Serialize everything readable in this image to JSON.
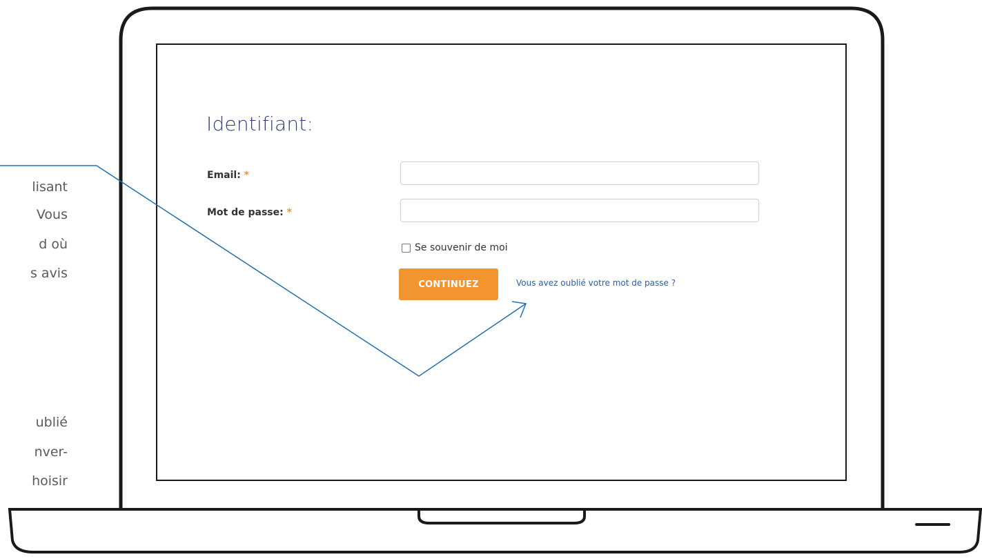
{
  "side_text": {
    "block1": [
      "lisant",
      "Vous",
      "d où",
      "s avis"
    ],
    "block2": [
      "ublié",
      "nver-",
      "hoisir"
    ]
  },
  "login": {
    "title": "Identifiant:",
    "email_label": "Email:",
    "password_label": "Mot de passe:",
    "required_marker": "*",
    "remember_label": "Se souvenir de moi",
    "remember_checked": false,
    "continue_label": "CONTINUEZ",
    "forgot_link": "Vous avez oublié votre mot de passe ?",
    "email_value": "",
    "password_value": ""
  },
  "colors": {
    "title": "#2c3e7f",
    "accent": "#f2942f",
    "link": "#2a5ea8",
    "callout_line": "#1f6fb0"
  }
}
